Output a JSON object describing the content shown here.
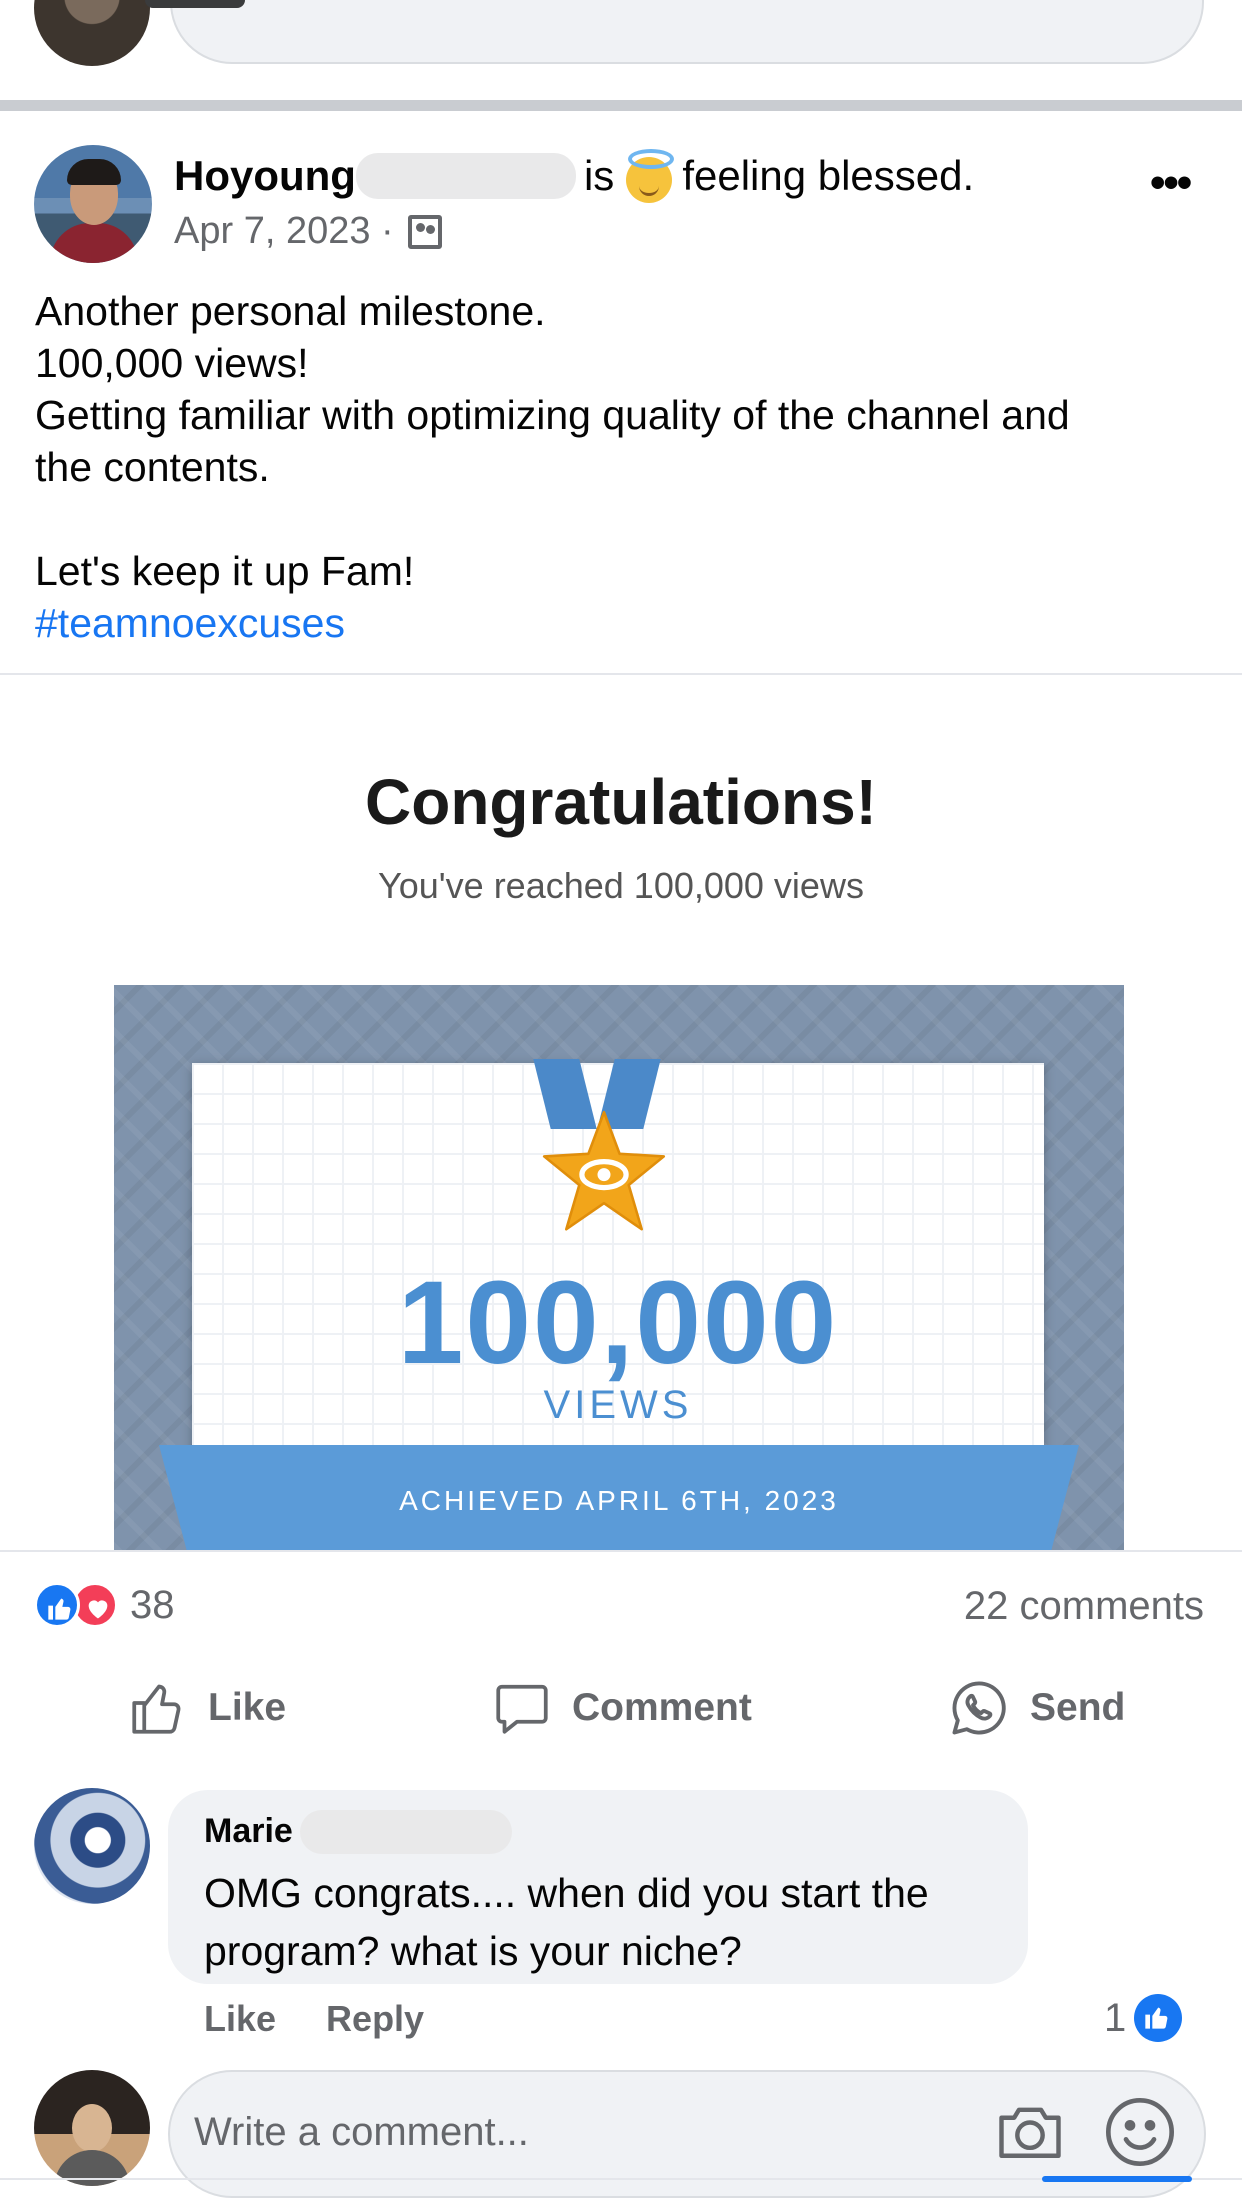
{
  "post": {
    "author": "Hoyoung",
    "feeling_prefix": "is",
    "feeling_text": "feeling blessed.",
    "feeling_emoji": "smiling-face-with-halo",
    "date": "Apr 7, 2023 ·",
    "audience_icon": "friends-icon",
    "text_lines": [
      "Another personal milestone.",
      "100,000 views!",
      "Getting familiar with optimizing quality of the channel and",
      "the contents.",
      "",
      "Let's keep it up Fam!"
    ],
    "hashtag": "#teamnoexcuses",
    "more_label": "•••"
  },
  "media": {
    "title": "Congratulations!",
    "subtitle": "You've reached 100,000 views",
    "number": "100,000",
    "unit": "VIEWS",
    "banner": "ACHIEVED APRIL 6TH, 2023"
  },
  "reactions": {
    "count": "38",
    "types": [
      "like",
      "love"
    ],
    "comments": "22 comments"
  },
  "actions": {
    "like": "Like",
    "comment": "Comment",
    "send": "Send"
  },
  "comment": {
    "author": "Marie",
    "text": "OMG congrats.... when did you start the program? what is your niche?",
    "like_label": "Like",
    "reply_label": "Reply",
    "likes": "1"
  },
  "composer": {
    "placeholder": "Write a comment..."
  },
  "colors": {
    "facebook_blue": "#1877f2",
    "love_red": "#f33e58",
    "secondary_text": "#65676b",
    "bubble_bg": "#f0f2f5",
    "certificate_blue": "#4b8fd1"
  }
}
